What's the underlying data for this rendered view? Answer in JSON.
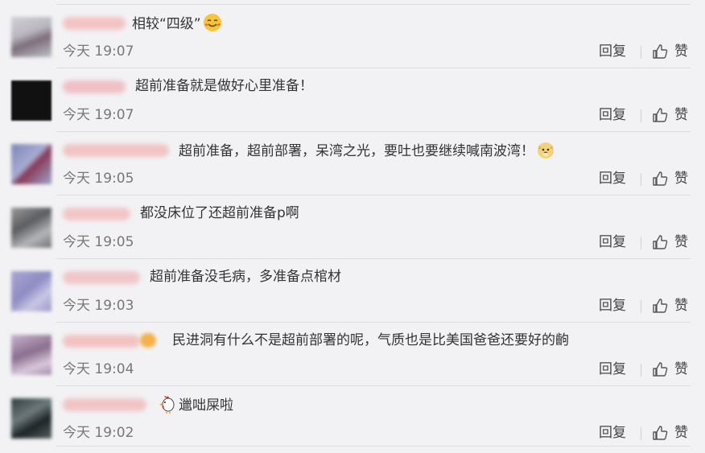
{
  "reply_label": "回复",
  "like_label": "赞",
  "comments": [
    {
      "text": "相较“四级”",
      "time": "今天 19:07",
      "emoji": "smiling-face-with-hearts-icon"
    },
    {
      "text": "超前准备就是做好心里准备！",
      "time": "今天 19:07"
    },
    {
      "text": "超前准备，超前部署，呆湾之光，要吐也要继续喊南波湾！",
      "time": "今天 19:05",
      "emoji": "doge-icon"
    },
    {
      "text": "都没床位了还超前准备p啊",
      "time": "今天 19:05"
    },
    {
      "text": "超前准备没毛病，多准备点棺材",
      "time": "今天 19:03"
    },
    {
      "text": "民进洞有什么不是超前部署的呢，气质也是比美国爸爸还要好的齣",
      "time": "今天 19:04"
    },
    {
      "text": "邋咄屎啦",
      "time": "今天 19:02",
      "emoji": "rooster-icon"
    }
  ]
}
